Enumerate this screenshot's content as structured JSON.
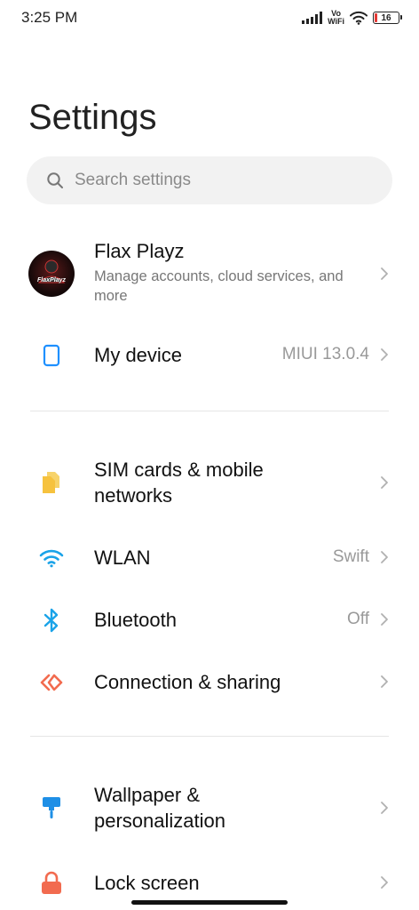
{
  "status_bar": {
    "time": "3:25 PM",
    "vowifi_top": "Vo",
    "vowifi_bottom": "WiFi",
    "battery": "16"
  },
  "page_title": "Settings",
  "search": {
    "placeholder": "Search settings"
  },
  "account": {
    "name": "Flax Playz",
    "subtitle": "Manage accounts, cloud services, and more",
    "avatar_text": "FlaxPlayz"
  },
  "my_device": {
    "title": "My device",
    "value": "MIUI 13.0.4"
  },
  "sim": {
    "title": "SIM cards & mobile networks"
  },
  "wlan": {
    "title": "WLAN",
    "value": "Swift"
  },
  "bluetooth": {
    "title": "Bluetooth",
    "value": "Off"
  },
  "connection": {
    "title": "Connection & sharing"
  },
  "wallpaper": {
    "title": "Wallpaper & personalization"
  },
  "lock_screen": {
    "title": "Lock screen"
  },
  "colors": {
    "device_icon": "#1e90ff",
    "sim_icon": "#f6c23e",
    "wlan_icon": "#1aa3e8",
    "bluetooth_icon": "#1aa3e8",
    "connection_icon": "#f26b4f",
    "wallpaper_icon": "#1e8fe6",
    "lock_icon": "#f26b4f"
  }
}
